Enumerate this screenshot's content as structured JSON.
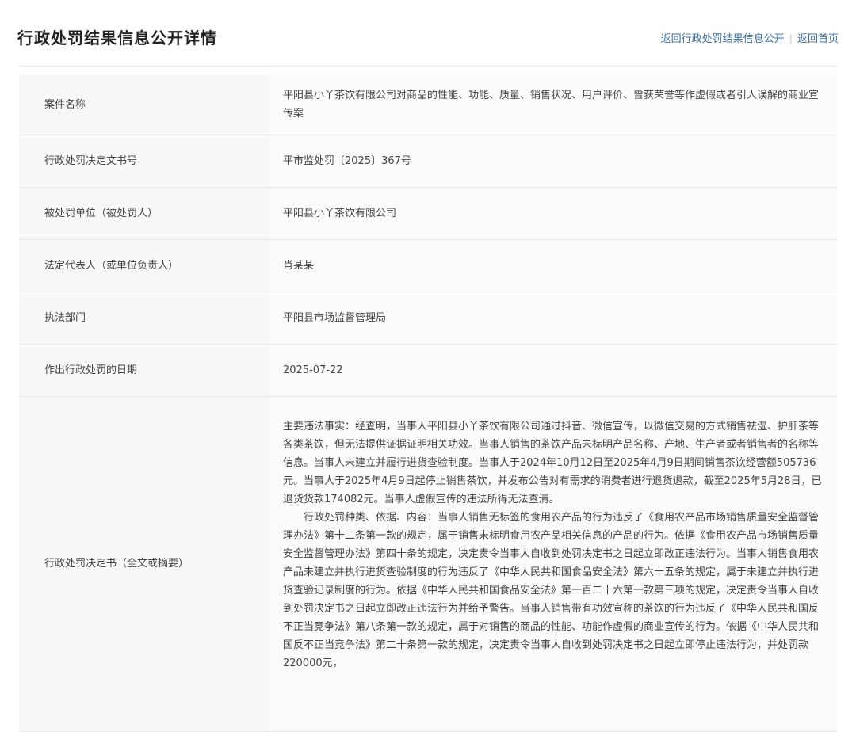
{
  "header": {
    "title": "行政处罚结果信息公开详情",
    "link_back_list": "返回行政处罚结果信息公开",
    "separator": "|",
    "link_home": "返回首页"
  },
  "rows": [
    {
      "label": "案件名称",
      "value": "平阳县小丫茶饮有限公司对商品的性能、功能、质量、销售状况、用户评价、曾获荣誉等作虚假或者引人误解的商业宣传案"
    },
    {
      "label": "行政处罚决定文书号",
      "value": "平市监处罚〔2025〕367号"
    },
    {
      "label": "被处罚单位（被处罚人）",
      "value": "平阳县小丫茶饮有限公司"
    },
    {
      "label": "法定代表人（或单位负责人）",
      "value": "肖某某"
    },
    {
      "label": "执法部门",
      "value": "平阳县市场监督管理局"
    },
    {
      "label": "作出行政处罚的日期",
      "value": "2025-07-22"
    },
    {
      "label": "行政处罚决定书（全文或摘要）",
      "paragraph1": "主要违法事实：经查明，当事人平阳县小丫茶饮有限公司通过抖音、微信宣传，以微信交易的方式销售祛湿、护肝茶等各类茶饮，但无法提供证据证明相关功效。当事人销售的茶饮产品未标明产品名称、产地、生产者或者销售者的名称等信息。当事人未建立并履行进货查验制度。当事人于2024年10月12日至2025年4月9日期间销售茶饮经营额505736元。当事人于2025年4月9日起停止销售茶饮，并发布公告对有需求的消费者进行退货退款，截至2025年5月28日，已退货货款174082元。当事人虚假宣传的违法所得无法查清。",
      "paragraph2": "行政处罚种类、依据、内容：当事人销售无标签的食用农产品的行为违反了《食用农产品市场销售质量安全监督管理办法》第十二条第一款的规定，属于销售未标明食用农产品相关信息的产品的行为。依据《食用农产品市场销售质量安全监督管理办法》第四十条的规定，决定责令当事人自收到处罚决定书之日起立即改正违法行为。当事人销售食用农产品未建立并执行进货查验制度的行为违反了《中华人民共和国食品安全法》第六十五条的规定，属于未建立并执行进货查验记录制度的行为。依据《中华人民共和国食品安全法》第一百二十六第一款第三项的规定，决定责令当事人自收到处罚决定书之日起立即改正违法行为并给予警告。当事人销售带有功效宣称的茶饮的行为违反了《中华人民共和国反不正当竞争法》第八条第一款的规定，属于对销售的商品的性能、功能作虚假的商业宣传的行为。依据《中华人民共和国反不正当竞争法》第二十条第一款的规定，决定责令当事人自收到处罚决定书之日起立即停止违法行为，并处罚款 220000元，"
    }
  ]
}
